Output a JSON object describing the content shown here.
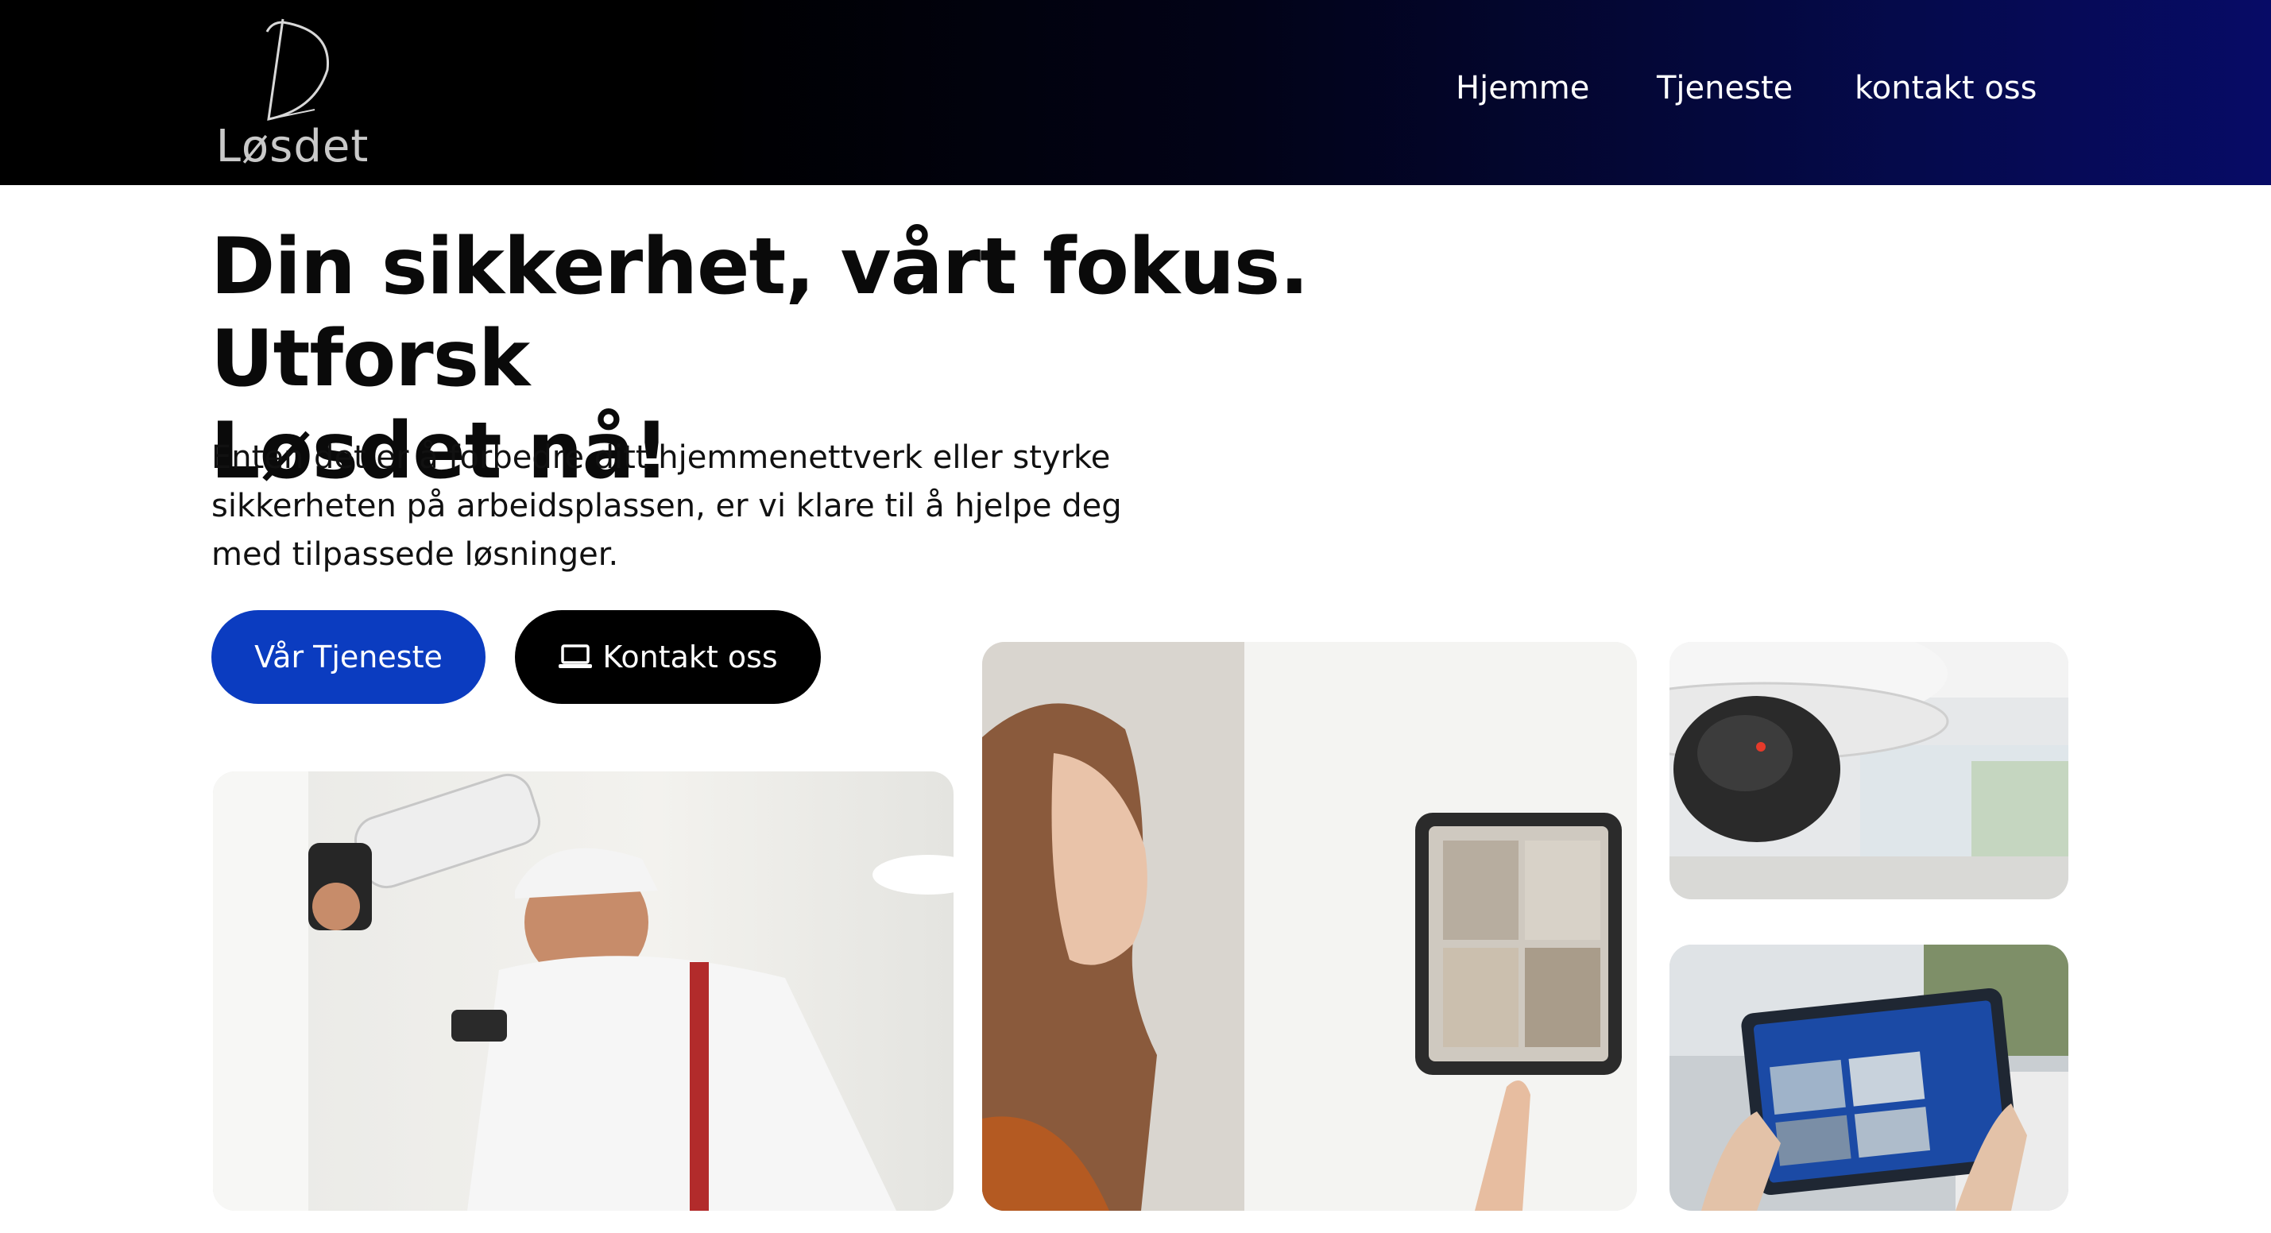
{
  "brand": {
    "logo_text": "Løsdet"
  },
  "nav": {
    "items": [
      {
        "label": "Hjemme"
      },
      {
        "label": "Tjeneste"
      },
      {
        "label": "kontakt oss"
      }
    ]
  },
  "hero": {
    "title_line1": "Din sikkerhet, vårt fokus. Utforsk",
    "title_line2": "Løsdet nå!",
    "text_line1": "Enten det er å forbedre ditt hjemmenettverk eller styrke",
    "text_line2": "sikkerheten på arbeidsplassen, er vi klare til å hjelpe deg",
    "text_line3": "med tilpassede løsninger."
  },
  "buttons": {
    "primary_label": "Vår Tjeneste",
    "secondary_label": "Kontakt oss",
    "secondary_icon": "laptop-icon"
  },
  "colors": {
    "primary_button": "#0b3cc0",
    "dark_button": "#000000",
    "header_gradient_end": "#070b66"
  }
}
